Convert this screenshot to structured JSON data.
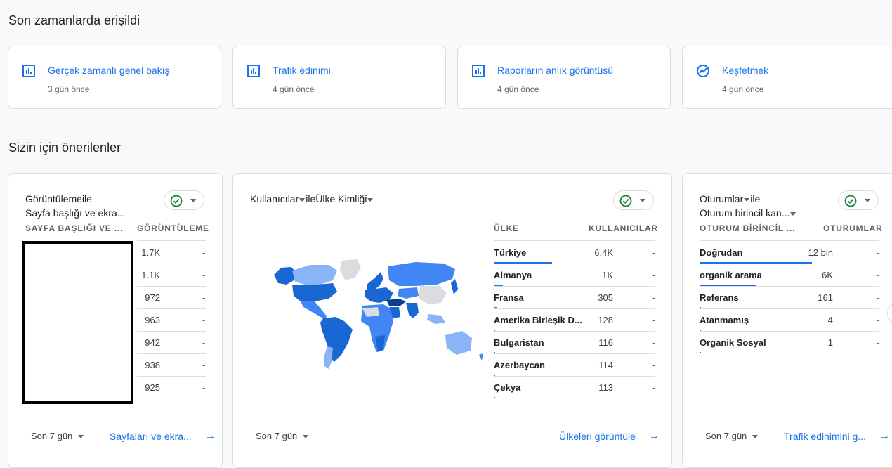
{
  "recent": {
    "title": "Son zamanlarda erişildi",
    "items": [
      {
        "icon": "bar-chart-icon",
        "name": "Gerçek zamanlı genel bakış",
        "time": "3 gün önce"
      },
      {
        "icon": "bar-chart-icon",
        "name": "Trafik edinimi",
        "time": "4 gün önce"
      },
      {
        "icon": "bar-chart-icon",
        "name": "Raporların anlık görüntüsü",
        "time": "4 gün önce"
      },
      {
        "icon": "explore-chart-icon",
        "name": "Keşfetmek",
        "time": "4 gün önce"
      }
    ]
  },
  "suggested": {
    "title": "Sizin için önerilenler",
    "cards": [
      {
        "title_line1": "Görüntülemeile",
        "title_line2": "Sayfa başlığı ve ekra...",
        "col1": "SAYFA BAŞLIĞI VE ...",
        "col2": "GÖRÜNTÜLEME",
        "rows": [
          {
            "value": "1.7K",
            "change": "-"
          },
          {
            "value": "1.1K",
            "change": "-"
          },
          {
            "value": "972",
            "change": "-"
          },
          {
            "value": "963",
            "change": "-"
          },
          {
            "value": "942",
            "change": "-"
          },
          {
            "value": "938",
            "change": "-"
          },
          {
            "value": "925",
            "change": "-"
          }
        ],
        "period": "Son 7 gün",
        "link": "Sayfaları ve ekra..."
      },
      {
        "title_metric": "Kullanıcılar",
        "title_mid": "ile",
        "title_dim": "Ülke Kimliği",
        "col1": "ÜLKE",
        "col2": "KULLANICILAR",
        "rows": [
          {
            "label": "Türkiye",
            "value": "6.4K",
            "change": "-",
            "share": 0.59
          },
          {
            "label": "Almanya",
            "value": "1K",
            "change": "-",
            "share": 0.09
          },
          {
            "label": "Fransa",
            "value": "305",
            "change": "-",
            "share": 0.03
          },
          {
            "label": "Amerika Birleşik D...",
            "value": "128",
            "change": "-",
            "share": 0.01
          },
          {
            "label": "Bulgaristan",
            "value": "116",
            "change": "-",
            "share": 0.01
          },
          {
            "label": "Azerbaycan",
            "value": "114",
            "change": "-",
            "share": 0.01
          },
          {
            "label": "Çekya",
            "value": "113",
            "change": "-",
            "share": 0.01
          }
        ],
        "period": "Son 7 gün",
        "link": "Ülkeleri görüntüle"
      },
      {
        "title_metric": "Oturumlar",
        "title_mid": "ile",
        "title_line2": "Oturum birincil kan...",
        "col1": "OTURUM BİRİNCİL ...",
        "col2": "OTURUMLAR",
        "rows": [
          {
            "label": "Doğrudan",
            "value": "12 bin",
            "change": "-",
            "share": 0.94
          },
          {
            "label": "organik arama",
            "value": "6K",
            "change": "-",
            "share": 0.47
          },
          {
            "label": "Referans",
            "value": "161",
            "change": "-",
            "share": 0.01
          },
          {
            "label": "Atanmamış",
            "value": "4",
            "change": "-",
            "share": 0.0
          },
          {
            "label": "Organik Sosyal",
            "value": "1",
            "change": "-",
            "share": 0.0
          }
        ],
        "period": "Son 7 gün",
        "link": "Trafik edinimini g..."
      }
    ]
  },
  "colors": {
    "accent": "#1a73e8",
    "check": "#188038",
    "map_dark": "#1967d2",
    "map_mid": "#4285f4",
    "map_light": "#8ab4f8",
    "map_none": "#dadce0"
  }
}
